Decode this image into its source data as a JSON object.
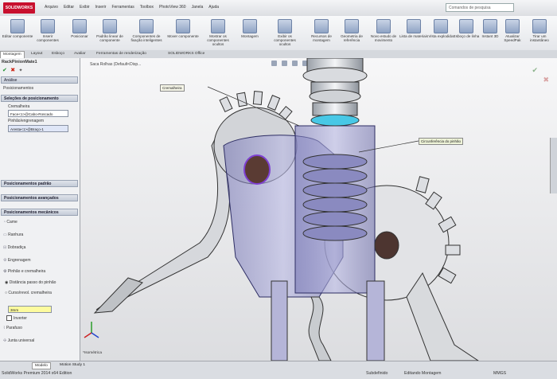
{
  "app": {
    "logo": "SOLIDWORKS"
  },
  "menu": [
    "Arquivo",
    "Editar",
    "Exibir",
    "Inserir",
    "Ferramentas",
    "Toolbox",
    "PhotoView 360",
    "Janela",
    "Ajuda"
  ],
  "search": {
    "placeholder": "Comandos de pesquisa"
  },
  "ribbon": [
    "Editar componente",
    "Inserir componentes",
    "Posicionar",
    "Padrão linear de componente",
    "Componentes de fixação inteligentes",
    "Mover componente",
    "Mostrar os componentes ocultos",
    "Montagem",
    "Exibir os componentes ocultos",
    "Recursos de montagem",
    "Geometria de referência",
    "Novo estudo de movimento",
    "Lista de materiais",
    "Vista explodida",
    "Esboço de linha",
    "Instant 3D",
    "Atualizar SpeedPak",
    "Tirar um instantâneo"
  ],
  "tabs": [
    "Montagem",
    "Layout",
    "Esboço",
    "Avaliar",
    "Ferramentas de renderização",
    "SOLIDWORKS Office"
  ],
  "panel": {
    "title": "RackPinionMate1",
    "analysis": "Análise",
    "positioning": "Posicionamentos",
    "sel_header": "Seleções de posicionamento",
    "rack_label": "Cremalheira",
    "rack_value": "Face<1>@Cabo-Roscado",
    "pinion_label": "Pinhão/engrenagem",
    "pinion_value": "Aresta<1>@Braço-1",
    "std_header": "Posicionamentos padrão",
    "adv_header": "Posicionamentos avançados",
    "mech_header": "Posicionamentos mecânicos",
    "items": [
      "Came",
      "Ranhura",
      "Dobradiça",
      "Engrenagem",
      "Pinhão e cremalheira"
    ],
    "opt1": "Distância passo do pinhão",
    "opt2": "Curso/revol. cremalheira",
    "value": "3mm",
    "invert": "Inverter",
    "screw": "Parafuso",
    "joint": "Junta universal"
  },
  "viewport": {
    "title": "Saca Rolhas (Default<Disp...",
    "callout1": "Cremalheira",
    "callout2": "Circunferência do pinhão"
  },
  "orientation": "*Isométrica",
  "status": {
    "tabs": [
      "Modelo",
      "Motion Study 1"
    ],
    "product": "SolidWorks Premium 2014 x64 Edition",
    "state": "Subdefinido",
    "mode": "Editando Montagem",
    "units": "MMGS"
  }
}
